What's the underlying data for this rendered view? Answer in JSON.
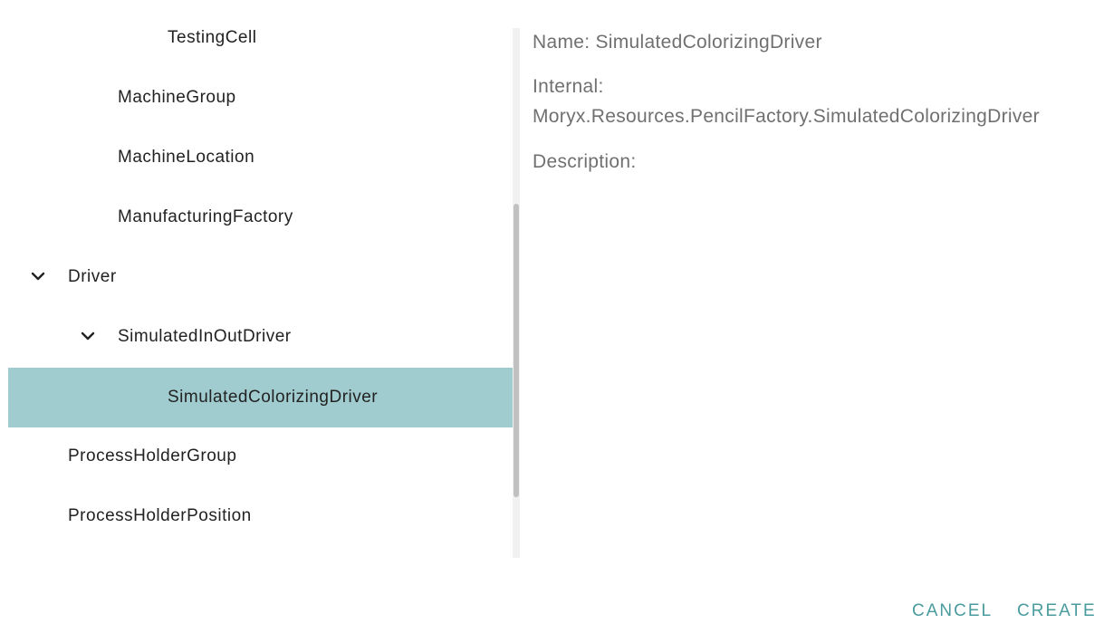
{
  "tree": {
    "nodes": [
      {
        "label": "TestingCell",
        "expanded": null,
        "selected": false
      },
      {
        "label": "MachineGroup",
        "expanded": null,
        "selected": false
      },
      {
        "label": "MachineLocation",
        "expanded": null,
        "selected": false
      },
      {
        "label": "ManufacturingFactory",
        "expanded": null,
        "selected": false
      },
      {
        "label": "Driver",
        "expanded": true,
        "selected": false
      },
      {
        "label": "SimulatedInOutDriver",
        "expanded": true,
        "selected": false
      },
      {
        "label": "SimulatedColorizingDriver",
        "expanded": null,
        "selected": true
      },
      {
        "label": "ProcessHolderGroup",
        "expanded": null,
        "selected": false
      },
      {
        "label": "ProcessHolderPosition",
        "expanded": null,
        "selected": false
      }
    ],
    "selected_color": "#a0cccf"
  },
  "details": {
    "name_line": "Name: SimulatedColorizingDriver",
    "internal_label": "Internal:",
    "internal_value": "Moryx.Resources.PencilFactory.SimulatedColorizingDriver",
    "description_label": "Description:"
  },
  "actions": {
    "cancel_label": "CANCEL",
    "create_label": "CREATE",
    "accent_color": "#4a9b9e"
  },
  "icons": {
    "expand": "chevron-down-icon"
  }
}
